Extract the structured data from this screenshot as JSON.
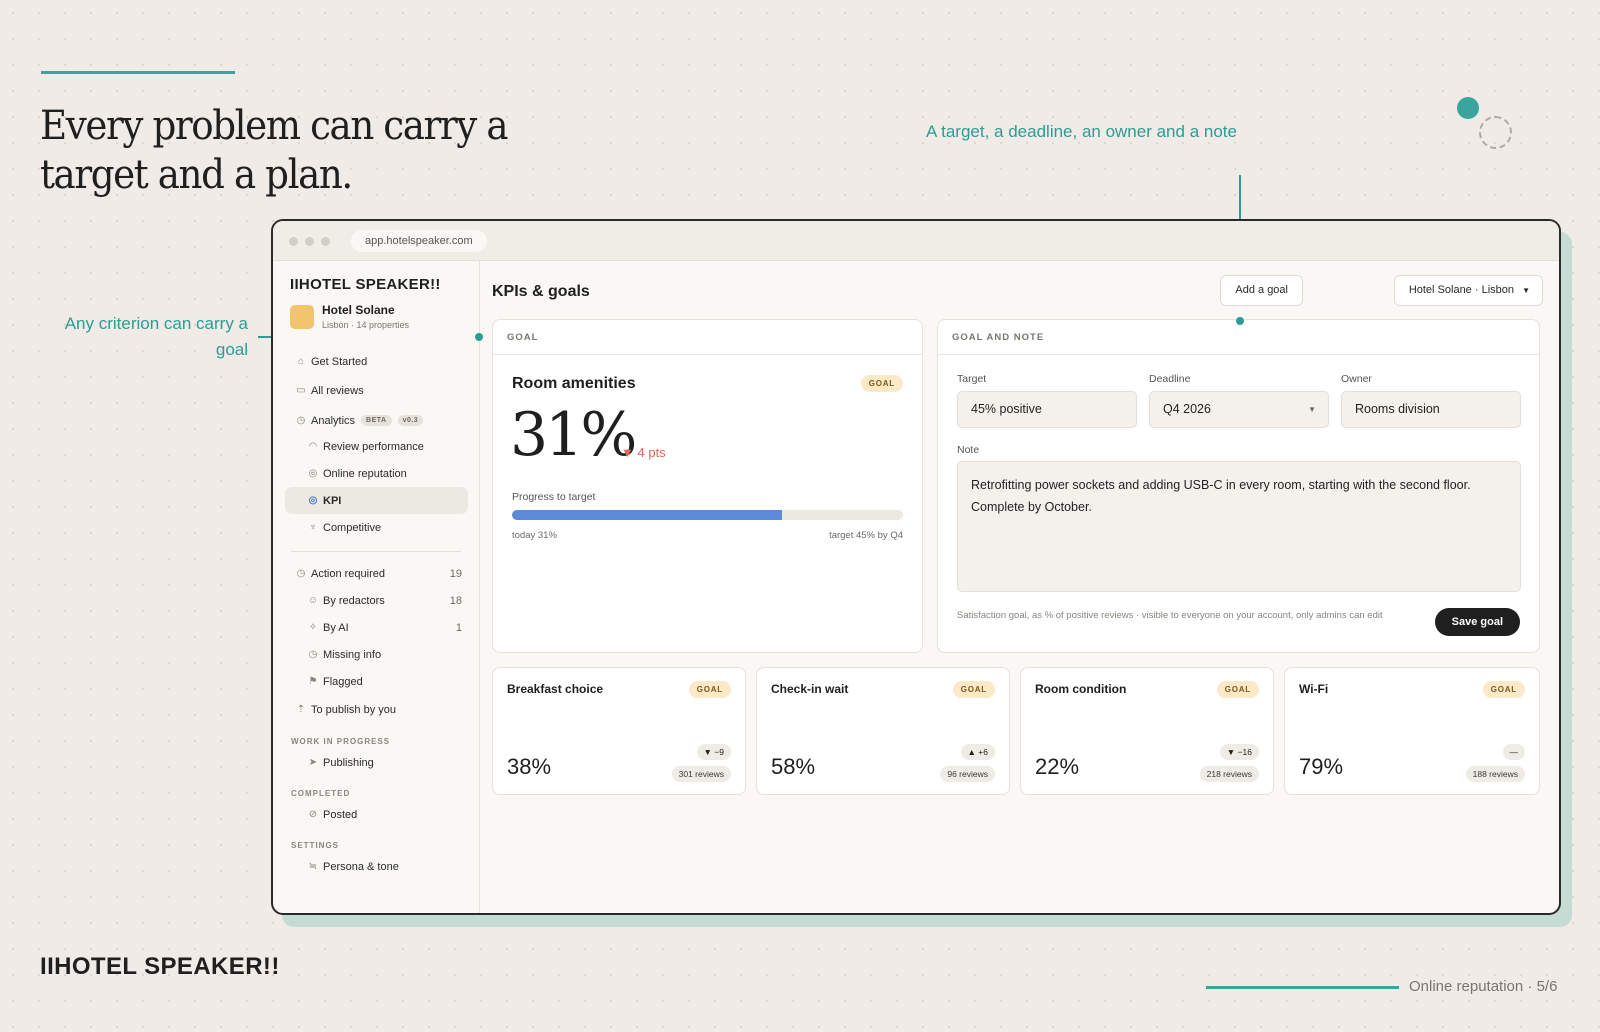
{
  "slide": {
    "headline": "Every problem can carry a target and a plan.",
    "callout_top": "A target, a deadline, an owner and a note",
    "callout_left": "Any criterion can carry a goal",
    "footer_logo": "IIHOTEL SPEAKER!!",
    "footer_text": "Online reputation · 5/6"
  },
  "browser": {
    "url": "app.hotelspeaker.com"
  },
  "sidebar": {
    "logo": "IIHOTEL SPEAKER!!",
    "hotel_name": "Hotel Solane",
    "hotel_sub": "Lisbon · 14 properties",
    "get_started": "Get Started",
    "all_reviews": "All reviews",
    "analytics": "Analytics",
    "analytics_badge_beta": "BETA",
    "analytics_badge_version": "v0.3",
    "review_performance": "Review performance",
    "online_reputation": "Online reputation",
    "kpi": "KPI",
    "competitive": "Competitive",
    "action_required": "Action required",
    "action_required_count": "19",
    "by_redactors": "By redactors",
    "by_redactors_count": "18",
    "by_ai": "By AI",
    "by_ai_count": "1",
    "missing_info": "Missing info",
    "flagged": "Flagged",
    "to_publish": "To publish by you",
    "section_wip": "WORK IN PROGRESS",
    "publishing": "Publishing",
    "section_completed": "COMPLETED",
    "posted": "Posted",
    "section_settings": "SETTINGS",
    "persona_tone": "Persona & tone"
  },
  "header": {
    "title": "KPIs & goals",
    "add_goal": "Add a goal",
    "hotel_select": "Hotel Solane · Lisbon"
  },
  "goal_card": {
    "header": "GOAL",
    "title": "Room amenities",
    "badge": "GOAL",
    "value": "31%",
    "delta": "4 pts",
    "progress_label": "Progress to target",
    "progress_fraction": 0.69,
    "progress_today": "today 31%",
    "progress_target": "target 45% by Q4"
  },
  "note_card": {
    "header": "GOAL AND NOTE",
    "target_label": "Target",
    "target_value": "45% positive",
    "deadline_label": "Deadline",
    "deadline_value": "Q4 2026",
    "owner_label": "Owner",
    "owner_value": "Rooms division",
    "note_label": "Note",
    "note_text": "Retrofitting power sockets and adding USB-C in every room, starting with the second floor. Complete by October.",
    "help_text": "Satisfaction goal, as % of positive reviews · visible to everyone on your account, only admins can edit",
    "save_button": "Save goal"
  },
  "kpi_cards": [
    {
      "title": "Breakfast choice",
      "badge": "GOAL",
      "value": "38%",
      "delta": "▼ −9",
      "reviews": "301 reviews"
    },
    {
      "title": "Check-in wait",
      "badge": "GOAL",
      "value": "58%",
      "delta": "▲ +6",
      "reviews": "96 reviews"
    },
    {
      "title": "Room condition",
      "badge": "GOAL",
      "value": "22%",
      "delta": "▼ −16",
      "reviews": "218 reviews"
    },
    {
      "title": "Wi-Fi",
      "badge": "GOAL",
      "value": "79%",
      "delta": "—",
      "reviews": "188 reviews"
    }
  ],
  "colors": {
    "accent_teal": "#2a9d95",
    "progress_blue": "#5b8ad6",
    "negative_red": "#e0665f",
    "goal_badge_bg": "#fbe9c7"
  }
}
